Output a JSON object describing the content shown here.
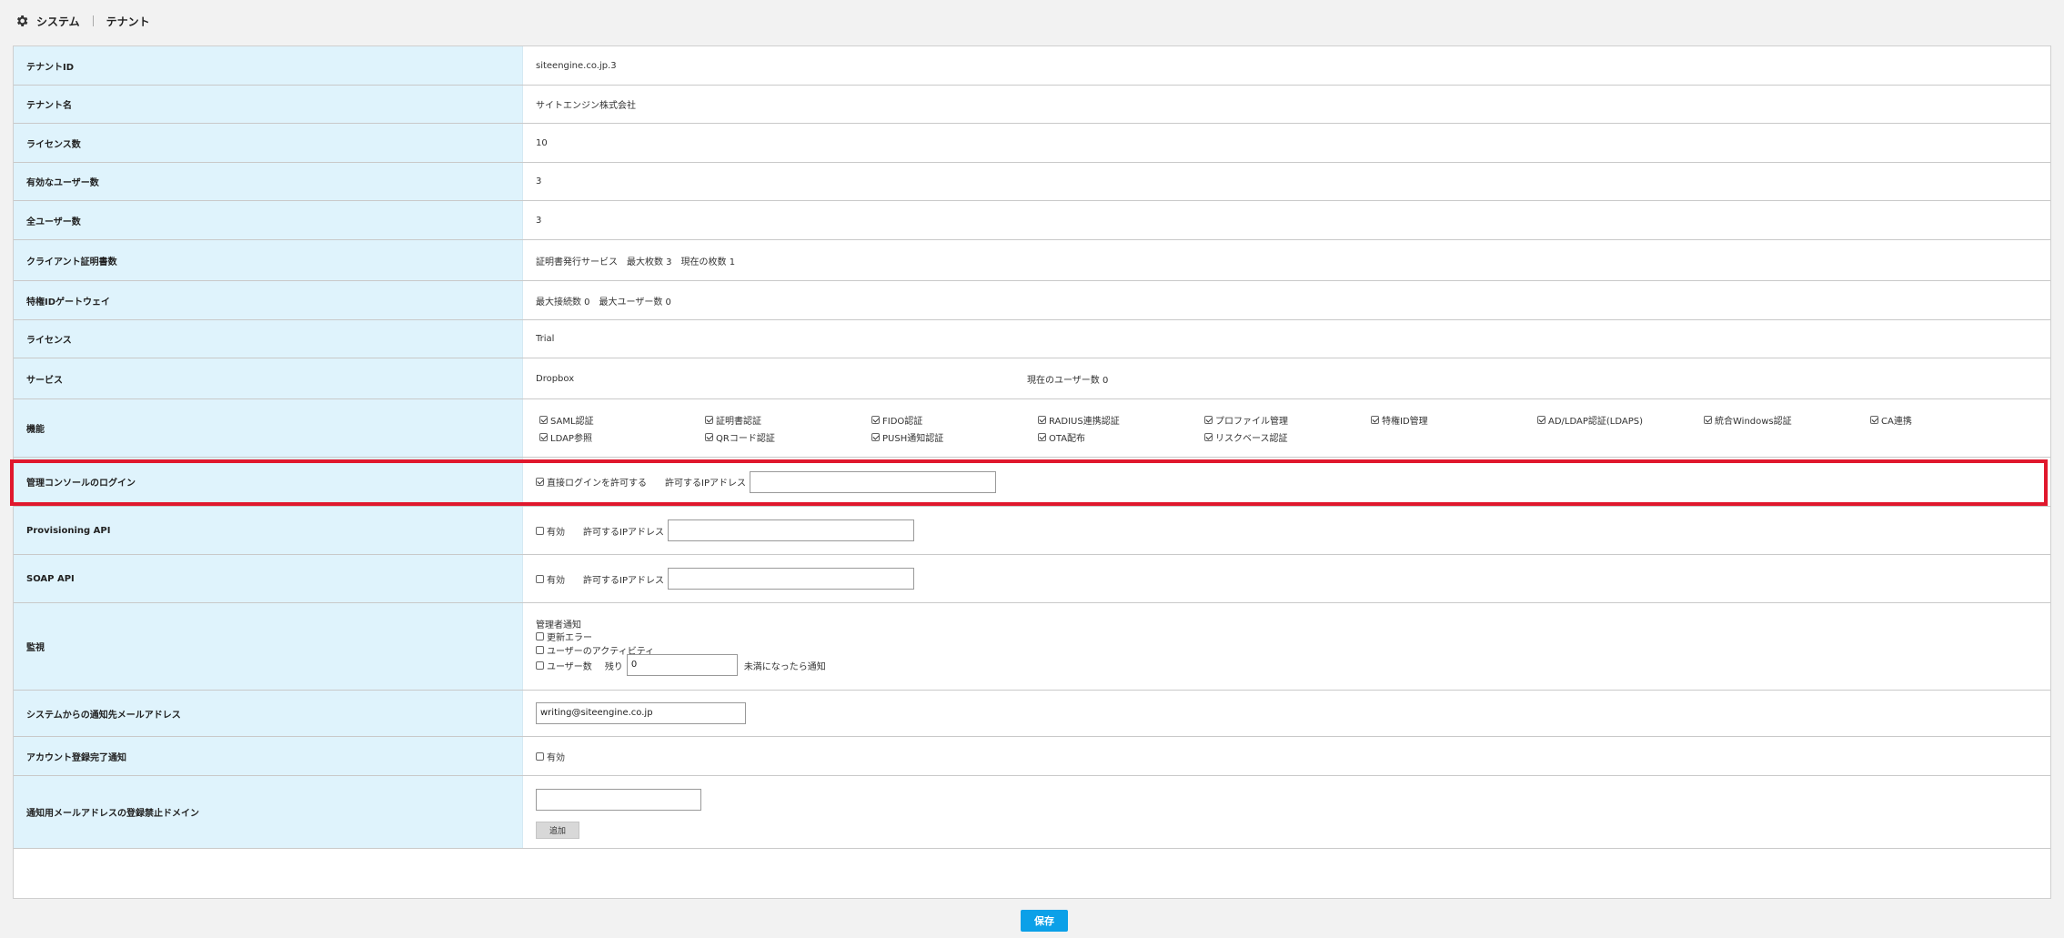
{
  "breadcrumb": {
    "system": "システム",
    "tenant": "テナント"
  },
  "rows": {
    "tenant_id": {
      "label": "テナントID",
      "value": "siteengine.co.jp.3"
    },
    "tenant_name": {
      "label": "テナント名",
      "value": "サイトエンジン株式会社"
    },
    "license_count": {
      "label": "ライセンス数",
      "value": "10"
    },
    "active_users": {
      "label": "有効なユーザー数",
      "value": "3"
    },
    "all_users": {
      "label": "全ユーザー数",
      "value": "3"
    },
    "client_cert": {
      "label": "クライアント証明書数",
      "value": "証明書発行サービス　最大枚数 3　現在の枚数 1"
    },
    "id_gateway": {
      "label": "特権IDゲートウェイ",
      "value": "最大接続数 0　最大ユーザー数 0"
    },
    "license": {
      "label": "ライセンス",
      "value": "Trial"
    },
    "service": {
      "label": "サービス",
      "name": "Dropbox",
      "current_users": "現在のユーザー数 0"
    },
    "features": {
      "label": "機能",
      "items": [
        "SAML認証",
        "証明書認証",
        "FIDO認証",
        "RADIUS連携認証",
        "プロファイル管理",
        "特権ID管理",
        "AD/LDAP認証(LDAPS)",
        "統合Windows認証",
        "CA連携",
        "LDAP参照",
        "QRコード認証",
        "PUSH通知認証",
        "OTA配布",
        "リスクベース認証"
      ]
    },
    "console_login": {
      "label": "管理コンソールのログイン",
      "checkbox": "直接ログインを許可する",
      "ip_label": "許可するIPアドレス",
      "ip_value": ""
    },
    "provisioning_api": {
      "label": "Provisioning API",
      "checkbox": "有効",
      "ip_label": "許可するIPアドレス",
      "ip_value": ""
    },
    "soap_api": {
      "label": "SOAP API",
      "checkbox": "有効",
      "ip_label": "許可するIPアドレス",
      "ip_value": ""
    },
    "monitoring": {
      "label": "監視",
      "admin_notice": "管理者通知",
      "update_error": "更新エラー",
      "user_activity": "ユーザーのアクティビティ",
      "user_count": "ユーザー数",
      "remaining": "残り",
      "remaining_value": "0",
      "notify_below": "未満になったら通知"
    },
    "notify_email": {
      "label": "システムからの通知先メールアドレス",
      "value": "writing@siteengine.co.jp"
    },
    "account_notice": {
      "label": "アカウント登録完了通知",
      "checkbox": "有効"
    },
    "blocked_domain": {
      "label": "通知用メールアドレスの登録禁止ドメイン",
      "value": "",
      "add_button": "追加"
    }
  },
  "save_button": "保存"
}
